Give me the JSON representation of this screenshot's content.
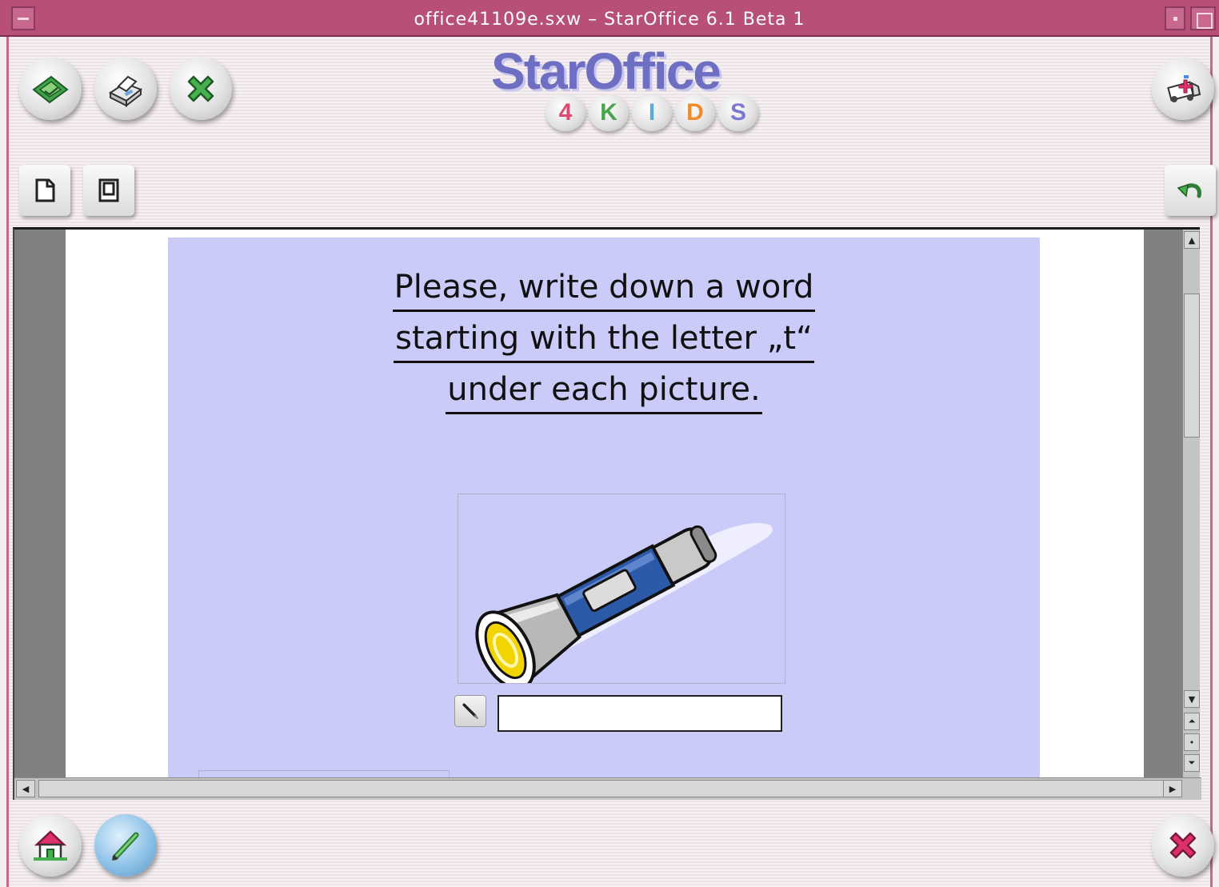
{
  "window": {
    "title": "office41109e.sxw – StarOffice 6.1 Beta 1"
  },
  "toolbar_top": {
    "buttons": [
      {
        "name": "open-icon"
      },
      {
        "name": "print-icon"
      },
      {
        "name": "close-document-icon"
      }
    ],
    "help_button": {
      "name": "ambulance-help-icon"
    }
  },
  "logo": {
    "brand": "StarOffice",
    "kids": [
      {
        "letter": "4",
        "color": "#e04a6f"
      },
      {
        "letter": "K",
        "color": "#4aa64a"
      },
      {
        "letter": "I",
        "color": "#5aaad8"
      },
      {
        "letter": "D",
        "color": "#f08a2a"
      },
      {
        "letter": "S",
        "color": "#7a7ad0"
      }
    ]
  },
  "toolbar_second": {
    "buttons": [
      {
        "name": "new-page-icon"
      },
      {
        "name": "save-page-icon"
      }
    ],
    "undo_button": {
      "name": "undo-arrow-icon"
    }
  },
  "document": {
    "instruction_lines": [
      "Please, write down a word",
      "starting with the letter „t“",
      "under each picture."
    ],
    "picture": "flashlight",
    "answer_value": ""
  },
  "bottom_bar": {
    "home": {
      "name": "home-icon"
    },
    "pencil": {
      "name": "pencil-icon"
    },
    "exit": {
      "name": "exit-x-icon"
    }
  },
  "colors": {
    "titlebar": "#b84f79",
    "page_background": "#cbcbf9",
    "logo": "#6e6ec2"
  }
}
